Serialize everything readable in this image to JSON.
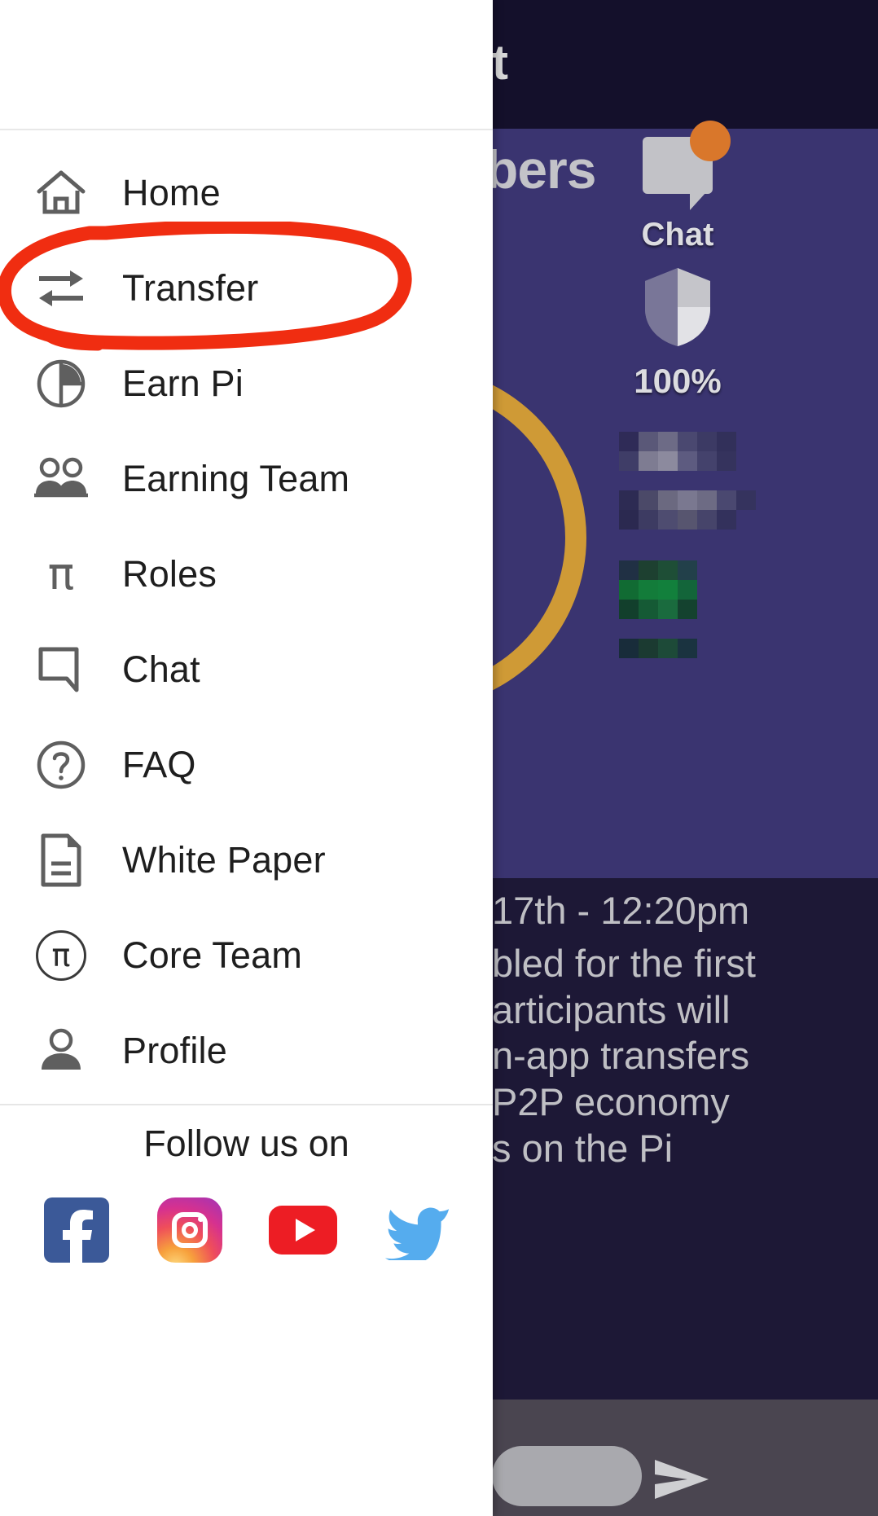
{
  "drawer": {
    "menu_items": [
      {
        "label": "Home",
        "icon": "home-icon"
      },
      {
        "label": "Transfer",
        "icon": "transfer-arrows-icon"
      },
      {
        "label": "Earn Pi",
        "icon": "pie-chart-icon"
      },
      {
        "label": "Earning Team",
        "icon": "people-group-icon"
      },
      {
        "label": "Roles",
        "icon": "pi-symbol-icon"
      },
      {
        "label": "Chat",
        "icon": "speech-bubble-icon"
      },
      {
        "label": "FAQ",
        "icon": "question-circle-icon"
      },
      {
        "label": "White Paper",
        "icon": "document-icon"
      },
      {
        "label": "Core Team",
        "icon": "pi-circle-icon"
      },
      {
        "label": "Profile",
        "icon": "person-icon"
      }
    ],
    "follow_label": "Follow us on",
    "social_links": [
      {
        "name": "facebook",
        "label": "Facebook",
        "color": "#3b5998"
      },
      {
        "name": "instagram",
        "label": "Instagram",
        "color": "#d6318f"
      },
      {
        "name": "youtube",
        "label": "YouTube",
        "color": "#ed1d24"
      },
      {
        "name": "twitter",
        "label": "Twitter",
        "color": "#55acee"
      }
    ]
  },
  "annotation": {
    "shape": "ellipse",
    "color": "#f02d11",
    "targets": "Transfer"
  },
  "background_app": {
    "status_text": "t",
    "header_title": "bers",
    "chat": {
      "label": "Chat",
      "badge_color": "#d9772b"
    },
    "shield": {
      "label": "100%"
    },
    "body_lines": [
      "17th - 12:20pm",
      "bled for the first",
      "articipants will",
      "n-app transfers",
      "P2P economy",
      "s on the Pi"
    ],
    "composer": {
      "send_icon": "send-icon"
    },
    "colors": {
      "panel": "#3a3470",
      "status_bar": "#14102b",
      "body": "#1d1836",
      "accent_gold": "#cf9a36",
      "accent_green": "#15803d"
    }
  }
}
